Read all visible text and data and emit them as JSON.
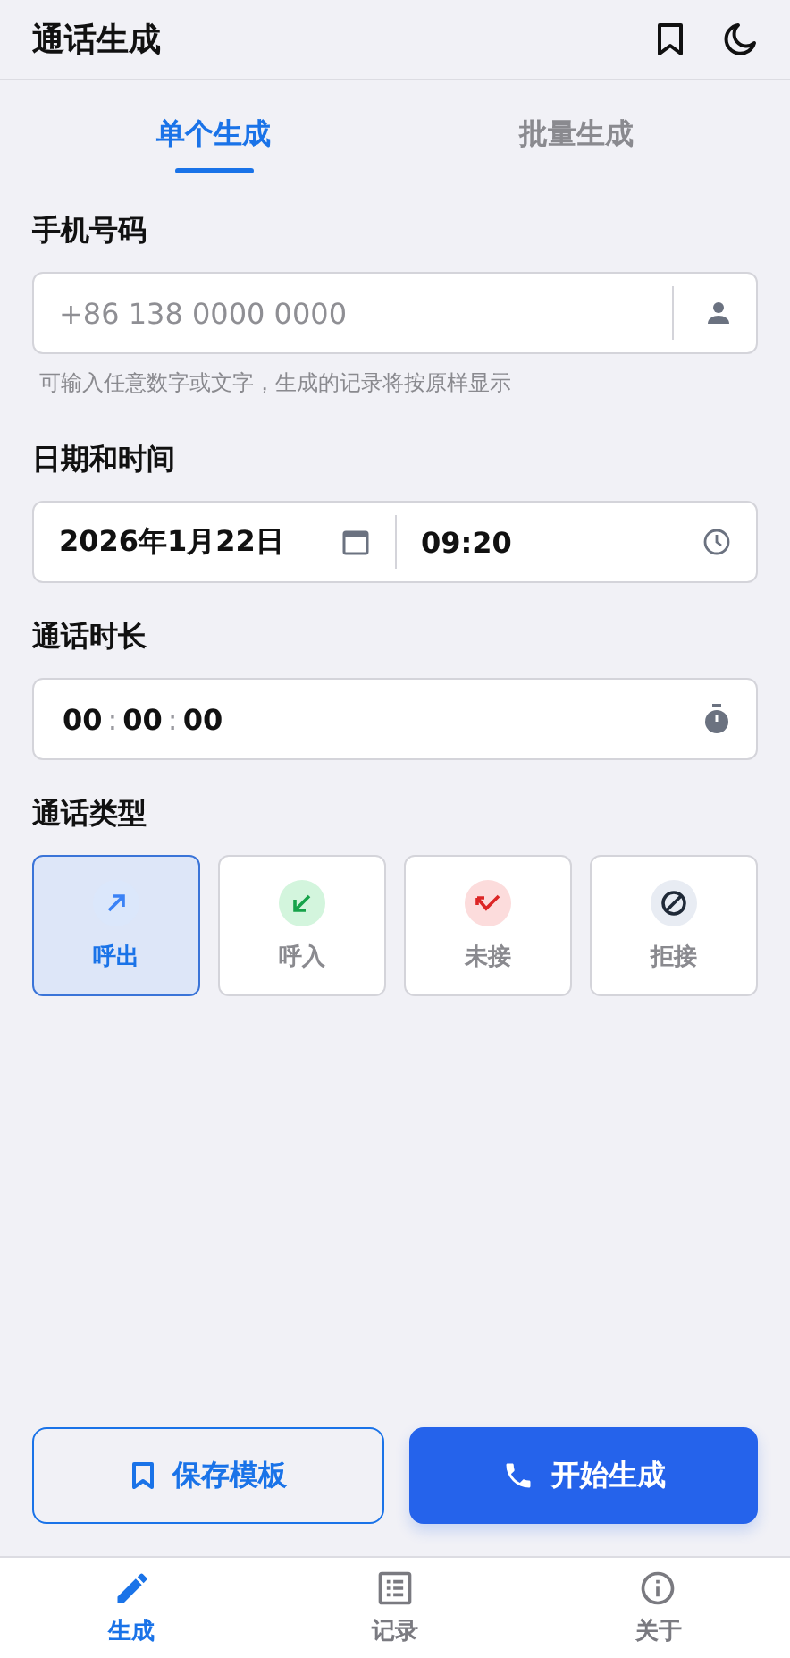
{
  "header": {
    "title": "通话生成"
  },
  "tabs": [
    {
      "label": "单个生成",
      "selected": true
    },
    {
      "label": "批量生成",
      "selected": false
    }
  ],
  "phone": {
    "label": "手机号码",
    "placeholder": "+86 138 0000 0000",
    "hint": "可输入任意数字或文字，生成的记录将按原样显示"
  },
  "datetime": {
    "label": "日期和时间",
    "date": "2026年1月22日",
    "time": "09:20"
  },
  "duration": {
    "label": "通话时长",
    "hours": "00",
    "sep1": ":",
    "minutes": "00",
    "sep2": ":",
    "seconds": "00"
  },
  "call_type": {
    "label": "通话类型",
    "options": [
      {
        "kind": "outgoing",
        "label": "呼出",
        "color": "#3b82f6",
        "selected": true
      },
      {
        "kind": "incoming",
        "label": "呼入",
        "color": "#16a34a",
        "selected": false
      },
      {
        "kind": "missed",
        "label": "未接",
        "color": "#dc2626",
        "selected": false
      },
      {
        "kind": "rejected",
        "label": "拒接",
        "color": "#1f2937",
        "selected": false
      }
    ]
  },
  "actions": {
    "save": "保存模板",
    "start": "开始生成"
  },
  "nav": [
    {
      "kind": "generate",
      "label": "生成",
      "selected": true
    },
    {
      "kind": "records",
      "label": "记录",
      "selected": false
    },
    {
      "kind": "about",
      "label": "关于",
      "selected": false
    }
  ]
}
